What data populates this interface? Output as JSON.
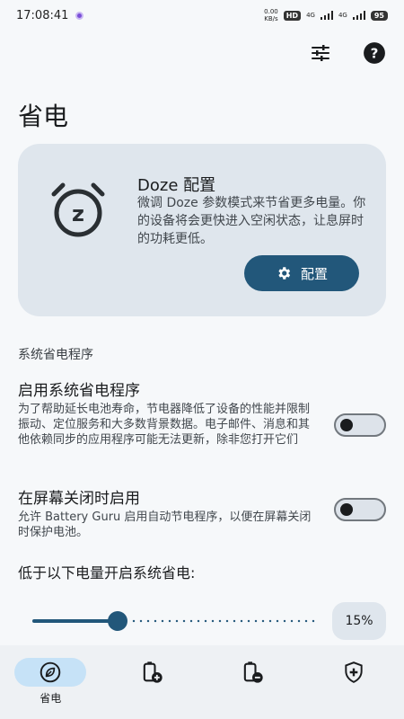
{
  "status_bar": {
    "time": "17:08:41",
    "speed": "0.00",
    "speed_unit": "KB/s",
    "hd_badge": "HD",
    "net1": "4G",
    "net2": "4G",
    "battery": "95"
  },
  "page": {
    "title": "省电"
  },
  "doze_card": {
    "title": "Doze 配置",
    "description": "微调 Doze 参数模式来节省更多电量。你的设备将会更快进入空闲状态，让息屏时的功耗更低。",
    "button_label": "配置"
  },
  "section": {
    "label": "系统省电程序"
  },
  "settings": [
    {
      "title": "启用系统省电程序",
      "description": "为了帮助延长电池寿命，节电器降低了设备的性能并限制振动、定位服务和大多数背景数据。电子邮件、消息和其他依赖同步的应用程序可能无法更新，除非您打开它们",
      "enabled": false
    },
    {
      "title": "在屏幕关闭时启用",
      "description": "允许 Battery Guru 启用自动节电程序，以便在屏幕关闭时保护电池。",
      "enabled": false
    }
  ],
  "threshold": {
    "label": "低于以下电量开启系统省电:",
    "value_text": "15%",
    "fraction": 0.3
  },
  "bottom_nav": [
    {
      "icon": "leaf-icon",
      "label": "省电",
      "active": true
    },
    {
      "icon": "battery-plus-icon",
      "label": "",
      "active": false
    },
    {
      "icon": "battery-minus-icon",
      "label": "",
      "active": false
    },
    {
      "icon": "shield-plus-icon",
      "label": "",
      "active": false
    }
  ],
  "colors": {
    "accent": "#22577a",
    "card_bg": "#dfe6ed",
    "nav_active": "#c6e2f7"
  }
}
